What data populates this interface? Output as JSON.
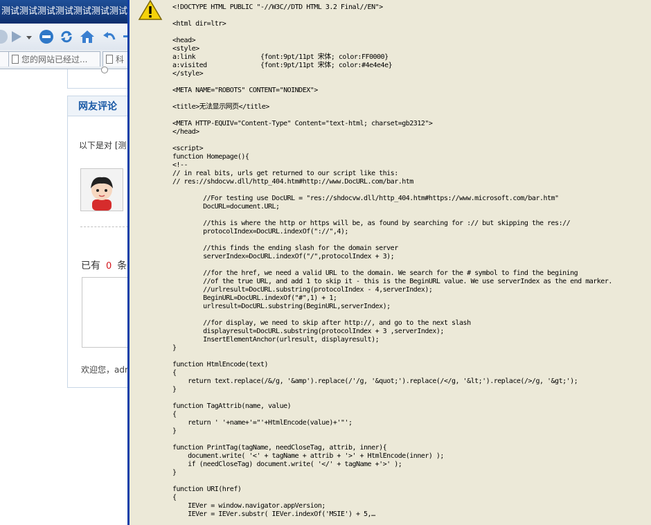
{
  "browser": {
    "title": "测试测试测试测试测试测试测试测试测试测试测试",
    "tabs": [
      {
        "label": "您的网站已经过..."
      },
      {
        "label": "科"
      }
    ]
  },
  "page": {
    "comments_title": "网友评论",
    "intro_text": "以下是对 [测",
    "count_prefix": "已有",
    "count_value": "0",
    "count_suffix": "条",
    "welcome_text": "欢迎您，adm"
  },
  "dialog": {
    "icon": "warning-icon",
    "code_lines": [
      "<!DOCTYPE HTML PUBLIC \"-//W3C//DTD HTML 3.2 Final//EN\">",
      "",
      "<html dir=ltr>",
      "",
      "<head>",
      "<style>",
      "a:link                 {font:9pt/11pt 宋体; color:FF0000}",
      "a:visited              {font:9pt/11pt 宋体; color:#4e4e4e}",
      "</style>",
      "",
      "<META NAME=\"ROBOTS\" CONTENT=\"NOINDEX\">",
      "",
      "<title>无法显示网页</title>",
      "",
      "<META HTTP-EQUIV=\"Content-Type\" Content=\"text-html; charset=gb2312\">",
      "</head>",
      "",
      "<script>",
      "function Homepage(){",
      "<!--",
      "// in real bits, urls get returned to our script like this:",
      "// res://shdocvw.dll/http_404.htm#http://www.DocURL.com/bar.htm",
      "",
      "        //For testing use DocURL = \"res://shdocvw.dll/http_404.htm#https://www.microsoft.com/bar.htm\"",
      "        DocURL=document.URL;",
      "",
      "        //this is where the http or https will be, as found by searching for :// but skipping the res://",
      "        protocolIndex=DocURL.indexOf(\"://\",4);",
      "",
      "        //this finds the ending slash for the domain server",
      "        serverIndex=DocURL.indexOf(\"/\",protocolIndex + 3);",
      "",
      "        //for the href, we need a valid URL to the domain. We search for the # symbol to find the begining",
      "        //of the true URL, and add 1 to skip it - this is the BeginURL value. We use serverIndex as the end marker.",
      "        //urlresult=DocURL.substring(protocolIndex - 4,serverIndex);",
      "        BeginURL=DocURL.indexOf(\"#\",1) + 1;",
      "        urlresult=DocURL.substring(BeginURL,serverIndex);",
      "",
      "        //for display, we need to skip after http://, and go to the next slash",
      "        displayresult=DocURL.substring(protocolIndex + 3 ,serverIndex);",
      "        InsertElementAnchor(urlresult, displayresult);",
      "}",
      "",
      "function HtmlEncode(text)",
      "{",
      "    return text.replace(/&/g, '&amp').replace(/'/g, '&quot;').replace(/</g, '&lt;').replace(/>/g, '&gt;');",
      "}",
      "",
      "function TagAttrib(name, value)",
      "{",
      "    return ' '+name+'=\"'+HtmlEncode(value)+'\"';",
      "}",
      "",
      "function PrintTag(tagName, needCloseTag, attrib, inner){",
      "    document.write( '<' + tagName + attrib + '>' + HtmlEncode(inner) );",
      "    if (needCloseTag) document.write( '</' + tagName +'>' );",
      "}",
      "",
      "function URI(href)",
      "{",
      "    IEVer = window.navigator.appVersion;",
      "    IEVer = IEVer.substr( IEVer.indexOf('MSIE') + 5,…"
    ]
  }
}
